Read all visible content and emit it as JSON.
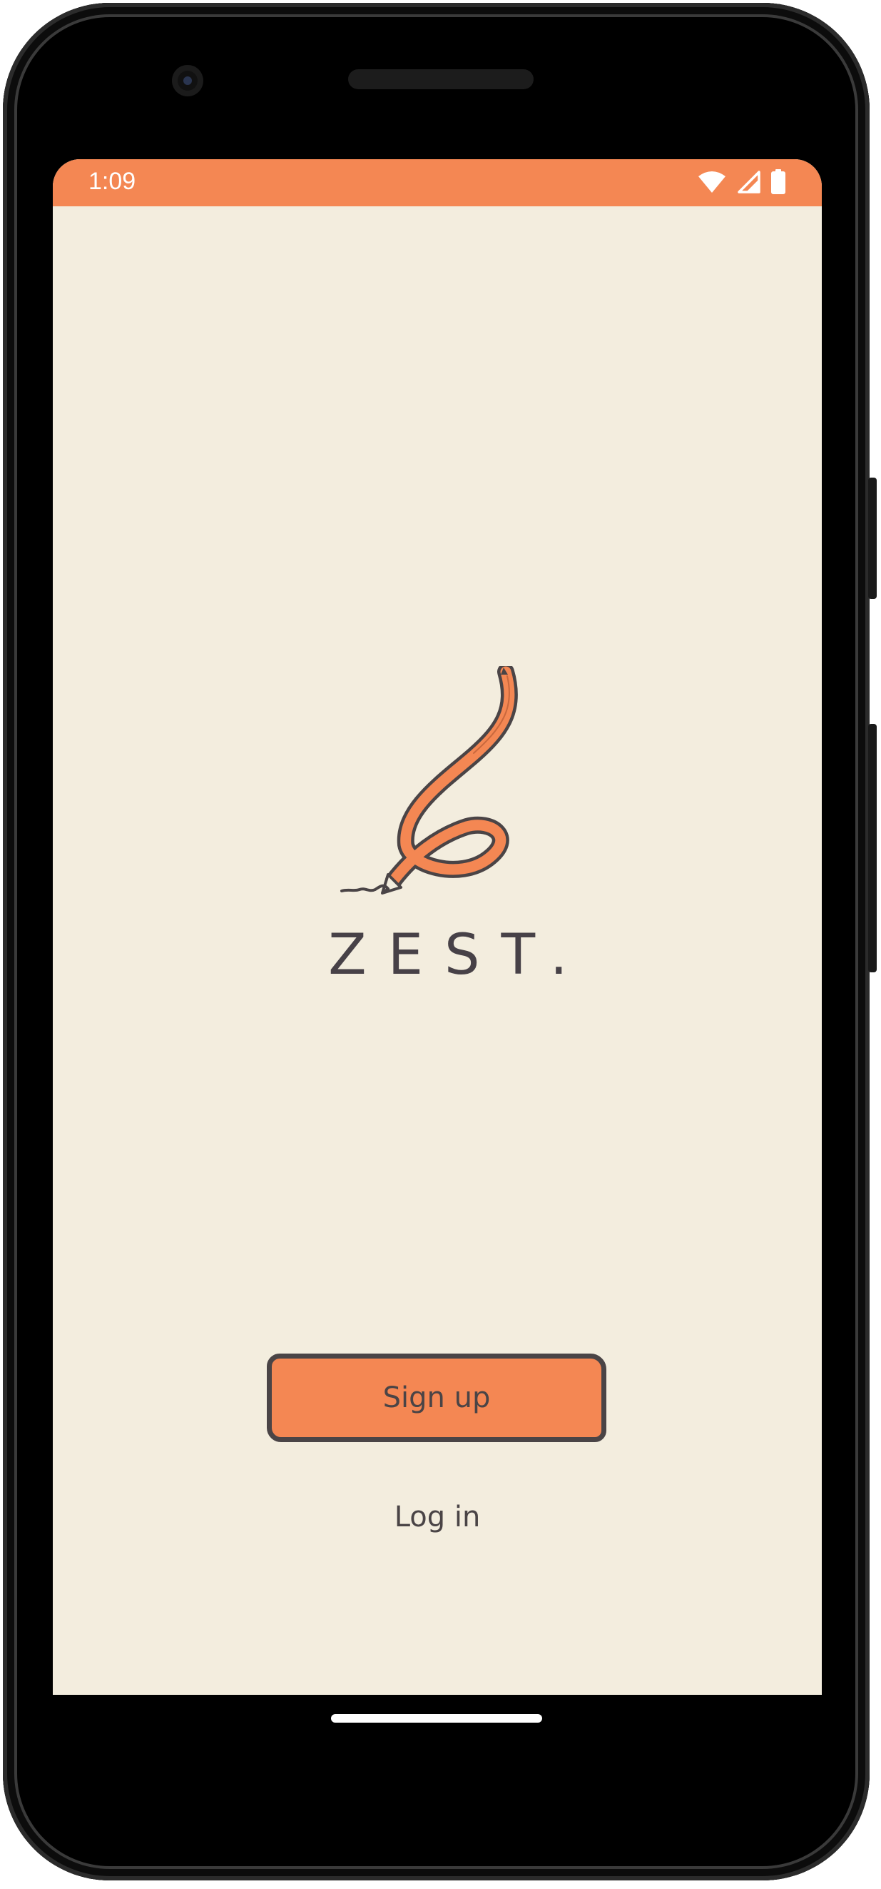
{
  "status_bar": {
    "time": "1:09",
    "background_color": "#F48753",
    "icons": [
      "wifi-icon",
      "signal-icon",
      "battery-icon"
    ]
  },
  "brand": {
    "name": "ZEST.",
    "logo_icon": "pencil-loop-logo-icon",
    "accent_color": "#F48753",
    "text_color": "#474147"
  },
  "actions": {
    "signup_label": "Sign up",
    "login_label": "Log in"
  },
  "screen": {
    "background_color": "#F3EDDE"
  }
}
